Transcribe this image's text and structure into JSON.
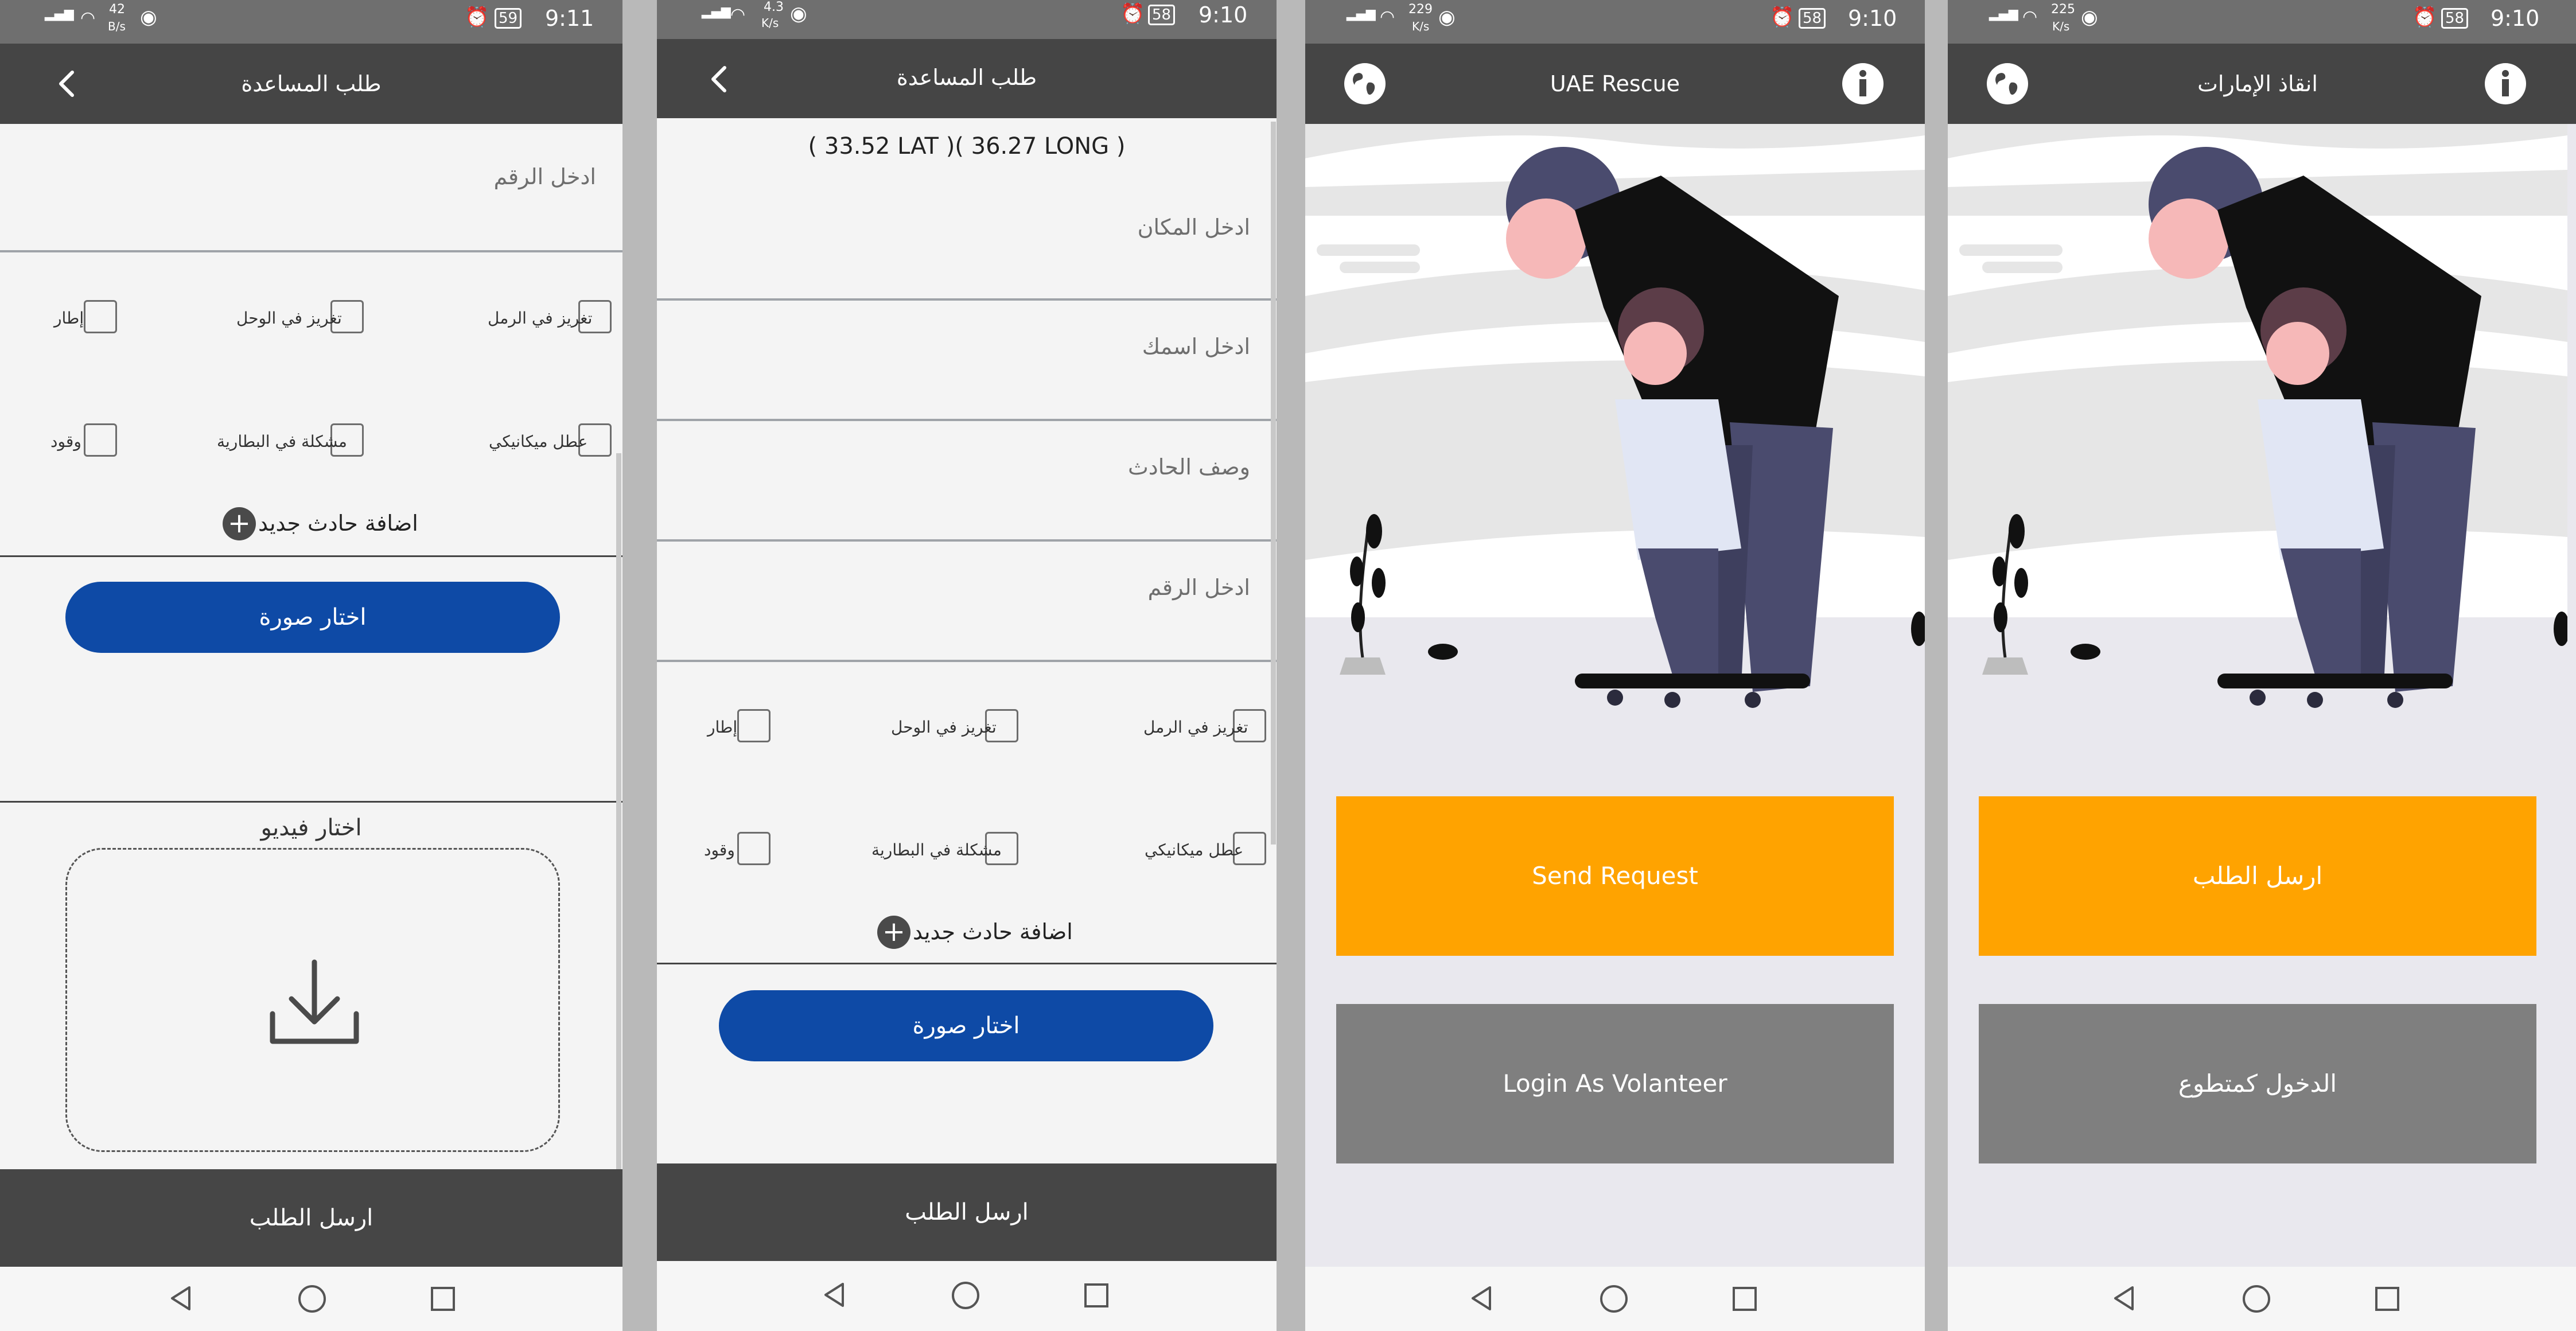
{
  "screens": [
    {
      "status": {
        "time": "9:11",
        "battery": "59",
        "net_speed": "42",
        "net_unit": "B/s",
        "signal": "3G"
      },
      "header": {
        "title": "طلب المساعدة"
      },
      "form": {
        "number_placeholder": "ادخل  الرقم"
      },
      "checkboxes": [
        "تغريز في الرمل",
        "تغريز في الوحل",
        "إطار",
        "عطل ميكانيكي",
        "مشكلة في البطارية",
        "وقود"
      ],
      "add_incident": "اضافة حادث جديد",
      "choose_image": "اختار صورة",
      "choose_video": "اختار فيديو",
      "submit": "ارسل الطلب"
    },
    {
      "status": {
        "time": "9:10",
        "battery": "58",
        "net_speed": "4.3",
        "net_unit": "K/s",
        "signal": "3G"
      },
      "header": {
        "title": "طلب المساعدة"
      },
      "coords": "( 33.52 LAT )( 36.27 LONG )",
      "form": {
        "place_placeholder": "ادخل المكان",
        "name_placeholder": "ادخل اسمك",
        "desc_placeholder": "وصف الحادث",
        "number_placeholder": "ادخل  الرقم"
      },
      "checkboxes": [
        "تغريز في الرمل",
        "تغريز في الوحل",
        "إطار",
        "عطل ميكانيكي",
        "مشكلة في البطارية",
        "وقود"
      ],
      "add_incident": "اضافة حادث جديد",
      "choose_image": "اختار صورة",
      "submit": "ارسل الطلب"
    },
    {
      "status": {
        "time": "9:10",
        "battery": "58",
        "net_speed": "229",
        "net_unit": "K/s",
        "signal": "3G"
      },
      "header": {
        "title": "UAE Rescue"
      },
      "send_request": "Send Request",
      "login_volunteer": "Login As Volanteer"
    },
    {
      "status": {
        "time": "9:10",
        "battery": "58",
        "net_speed": "225",
        "net_unit": "K/s",
        "signal": "3G"
      },
      "header": {
        "title": "انقاذ الإمارات"
      },
      "send_request": "ارسل الطلب",
      "login_volunteer": "الدخول كمتطوع"
    }
  ],
  "colors": {
    "primary_blue": "#0e4aa6",
    "orange": "#ffa300",
    "gray_button": "#7f7f7f",
    "appbar": "#454545"
  },
  "icons": [
    "back-arrow-icon",
    "globe-icon",
    "info-icon",
    "download-icon",
    "plus-icon",
    "nav-back-icon",
    "nav-home-icon",
    "nav-recents-icon"
  ]
}
